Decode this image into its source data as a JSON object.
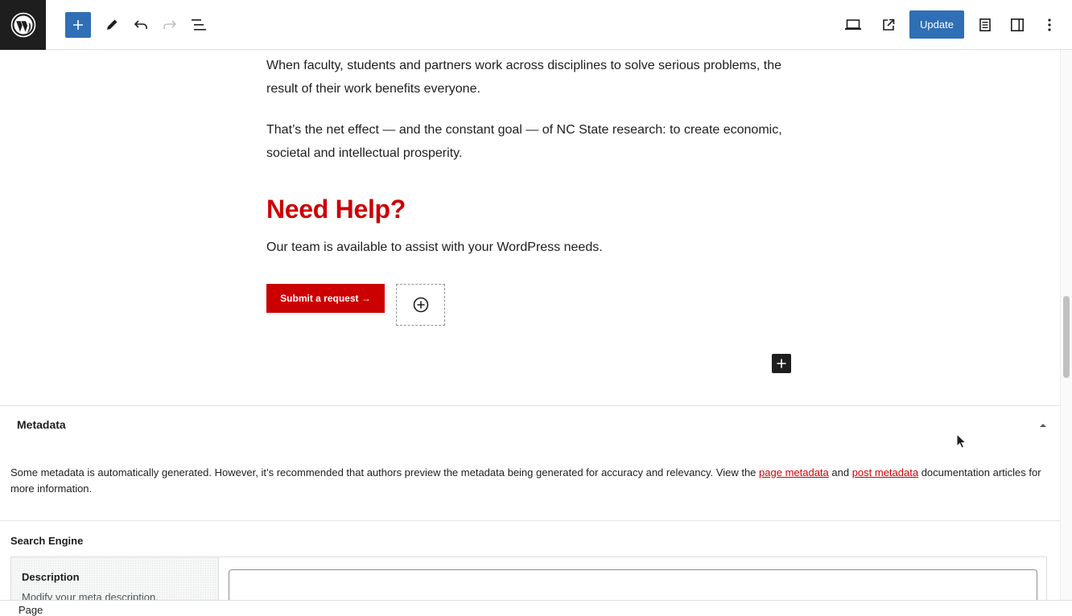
{
  "toolbar": {
    "logo_icon": "wordpress-logo",
    "update_label": "Update",
    "accent": "#2f6fb5"
  },
  "content": {
    "paragraph1": "When faculty, students and partners work across disciplines to solve serious problems, the result of their work benefits everyone.",
    "paragraph2": "That’s the net effect — and the constant goal — of NC State research: to create economic, societal and intellectual prosperity.",
    "heading": "Need Help?",
    "paragraph3": "Our team is available to assist with your WordPress needs.",
    "button_label": "Submit a request →",
    "brand_color": "#cc0000"
  },
  "metadata": {
    "title": "Metadata",
    "description_before": "Some metadata is automatically generated. However, it’s recommended that authors preview the metadata being generated for accuracy and relevancy. View the ",
    "link1": "page metadata",
    "between": " and ",
    "link2": "post metadata",
    "description_after": " documentation articles for more information.",
    "search_engine_title": "Search Engine",
    "description_label": "Description",
    "description_hint": "Modify your meta description.",
    "description_value": ""
  },
  "footer": {
    "breadcrumb": "Page"
  }
}
